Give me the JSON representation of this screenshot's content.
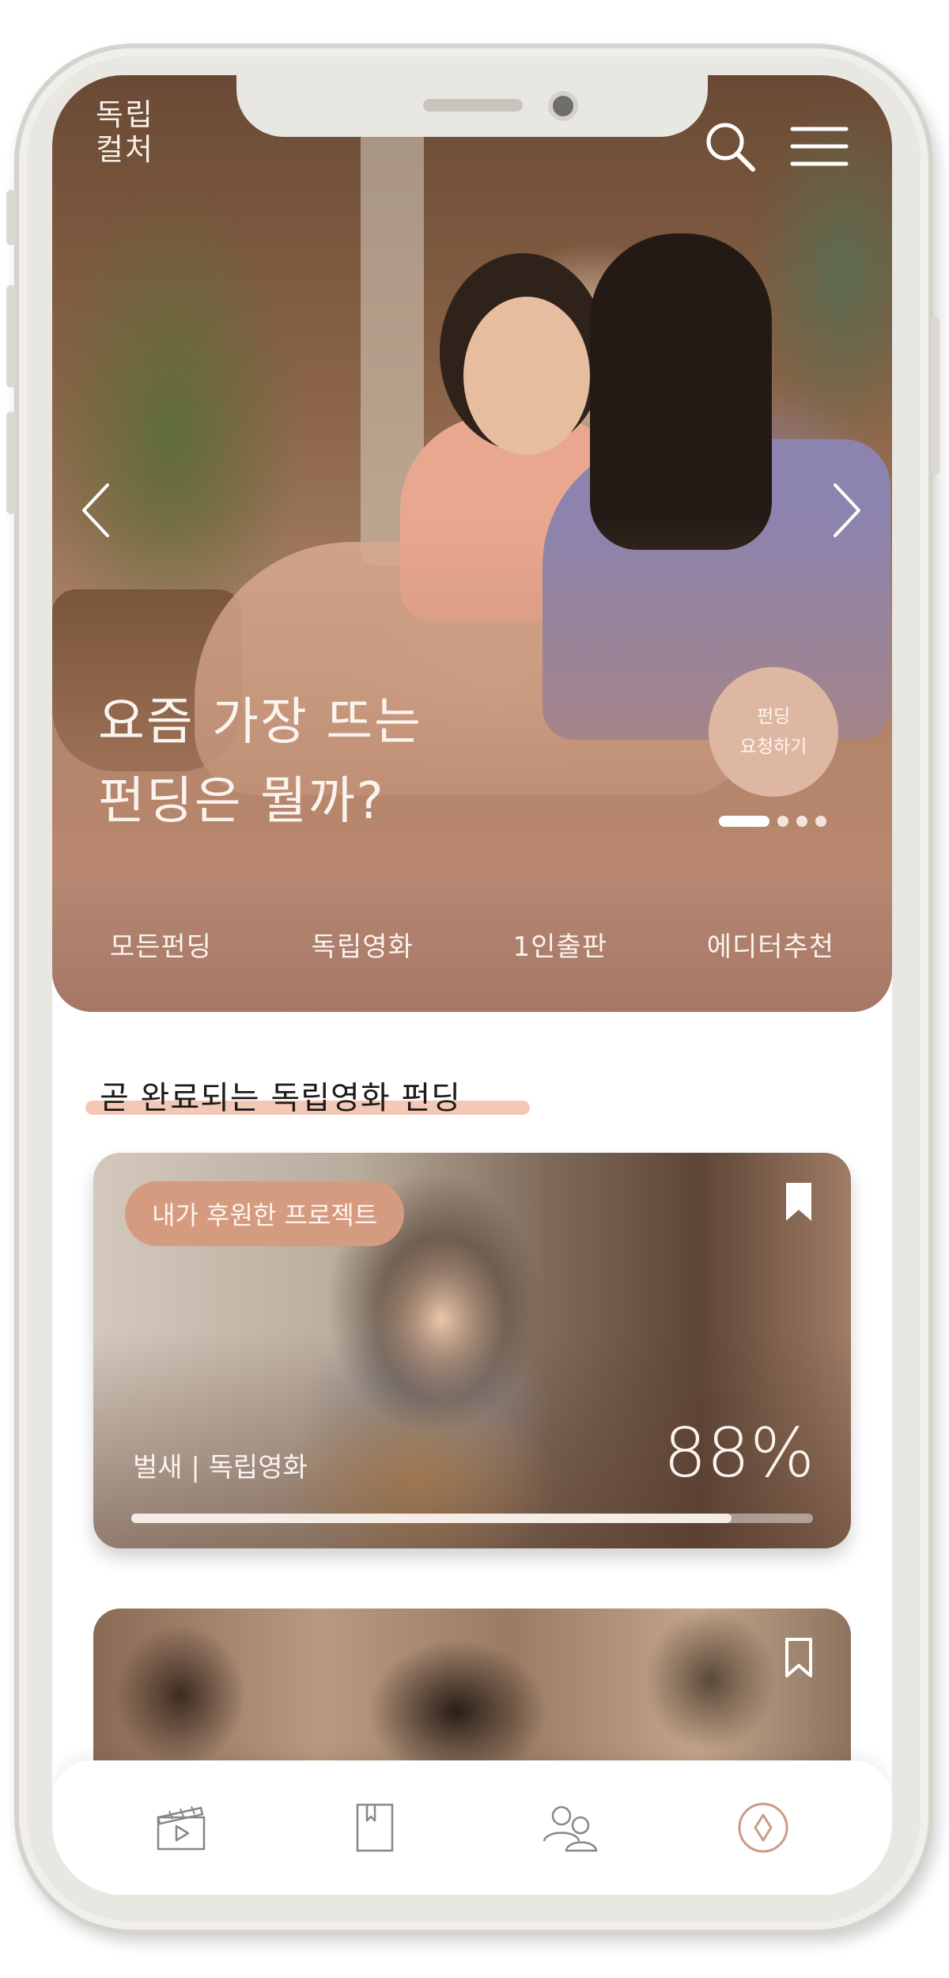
{
  "header": {
    "logo_text": "독립\n컬처",
    "search_icon": "search-icon",
    "menu_icon": "menu-icon"
  },
  "hero": {
    "title_line1": "요즘 가장 뜨는",
    "title_line2": "펀딩은 뭘까?",
    "badge_line1": "펀딩",
    "badge_line2": "요청하기",
    "slide_count": 4,
    "active_slide": 1
  },
  "categories": [
    {
      "label": "모든펀딩"
    },
    {
      "label": "독립영화"
    },
    {
      "label": "1인출판"
    },
    {
      "label": "에디터추천"
    }
  ],
  "section": {
    "title": "곧 완료되는 독립영화 펀딩"
  },
  "cards": [
    {
      "tag": "내가 후원한 프로젝트",
      "meta": "벌새 | 독립영화",
      "percent_label": "88%",
      "progress": 0.88,
      "bookmarked": true
    },
    {
      "bookmarked": false
    }
  ],
  "bottom_nav": [
    {
      "icon": "film-icon"
    },
    {
      "icon": "book-icon"
    },
    {
      "icon": "people-icon"
    },
    {
      "icon": "compass-icon"
    }
  ],
  "colors": {
    "accent": "#c59a84",
    "tag_bg": "#d59b80",
    "underline": "#f4c8b6",
    "category_bar": "#b08170"
  }
}
